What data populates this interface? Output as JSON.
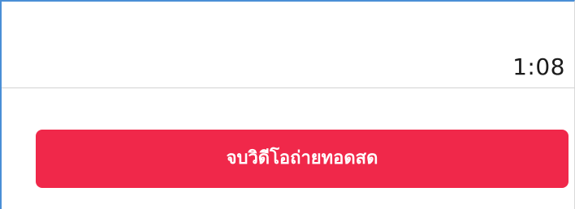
{
  "live_panel": {
    "elapsed_time": "1:08",
    "end_button_label": "จบวิดีโอถ่ายทอดสด",
    "accent_color": "#f0284a"
  }
}
